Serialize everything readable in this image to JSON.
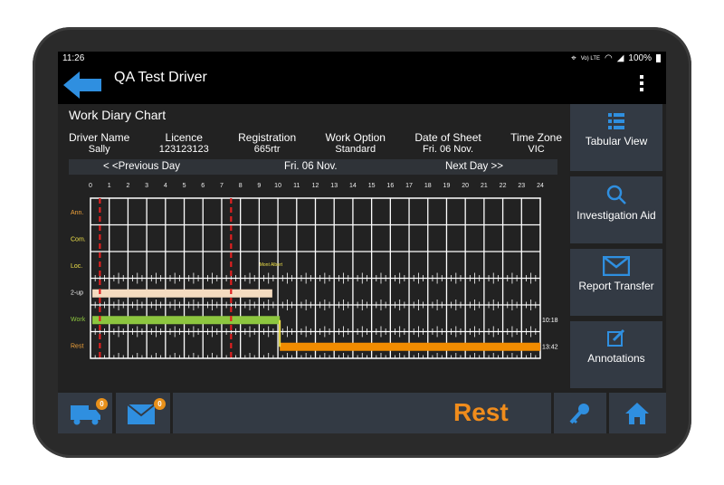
{
  "status_bar": {
    "time": "11:26",
    "network": "Vo) LTE",
    "battery": "100%"
  },
  "app": {
    "title": "QA Test Driver"
  },
  "chart_title": "Work Diary Chart",
  "meta": [
    {
      "header": "Driver Name",
      "value": "Sally"
    },
    {
      "header": "Licence",
      "value": "123123123"
    },
    {
      "header": "Registration",
      "value": "665rtr"
    },
    {
      "header": "Work Option",
      "value": "Standard"
    },
    {
      "header": "Date of Sheet",
      "value": "Fri. 06 Nov."
    },
    {
      "header": "Time Zone",
      "value": "VIC"
    }
  ],
  "day_nav": {
    "prev": "< <Previous Day",
    "current": "Fri. 06 Nov.",
    "next": "Next Day >>"
  },
  "chart_data": {
    "type": "timeline",
    "x_ticks": [
      "0",
      "1",
      "2",
      "3",
      "4",
      "5",
      "6",
      "7",
      "8",
      "9",
      "10",
      "11",
      "12",
      "13",
      "14",
      "15",
      "16",
      "17",
      "18",
      "19",
      "20",
      "21",
      "22",
      "23",
      "24"
    ],
    "rows": [
      {
        "label": "Ann.",
        "color": "#f2a33a"
      },
      {
        "label": "Com.",
        "color": "#f0e24a"
      },
      {
        "label": "Loc.",
        "color": "#f0e24a"
      },
      {
        "label": "2-up",
        "color": "#f1f1f1"
      },
      {
        "label": "Work",
        "color": "#8dc63f"
      },
      {
        "label": "Rest",
        "color": "#f2a33a"
      }
    ],
    "segments": [
      {
        "row": "2-up",
        "start": 0.1,
        "end": 9.7,
        "color": "#f5dcc0"
      },
      {
        "row": "Work",
        "start": 0.1,
        "end": 10.1,
        "color": "#8dc63f"
      },
      {
        "row": "Rest",
        "start": 10.1,
        "end": 24,
        "color": "#f28c00"
      }
    ],
    "row_totals": [
      {
        "row": "Work",
        "value": "10:18"
      },
      {
        "row": "Rest",
        "value": "13:42"
      }
    ],
    "red_markers": [
      0.5,
      7.5
    ],
    "location_label": {
      "text": "Mont Albert",
      "hour": 9.5,
      "row": "Loc."
    }
  },
  "sidebar": [
    {
      "label": "Tabular View",
      "icon": "list-icon"
    },
    {
      "label": "Investigation Aid",
      "icon": "search-icon"
    },
    {
      "label": "Report Transfer",
      "icon": "mail-icon"
    },
    {
      "label": "Annotations",
      "icon": "edit-icon"
    }
  ],
  "bottom": {
    "truck_badge": "0",
    "mail_badge": "0",
    "current_status": "Rest"
  },
  "colors": {
    "accent_blue": "#2f8fe0",
    "orange": "#f08c1c",
    "panel": "#333a44"
  }
}
